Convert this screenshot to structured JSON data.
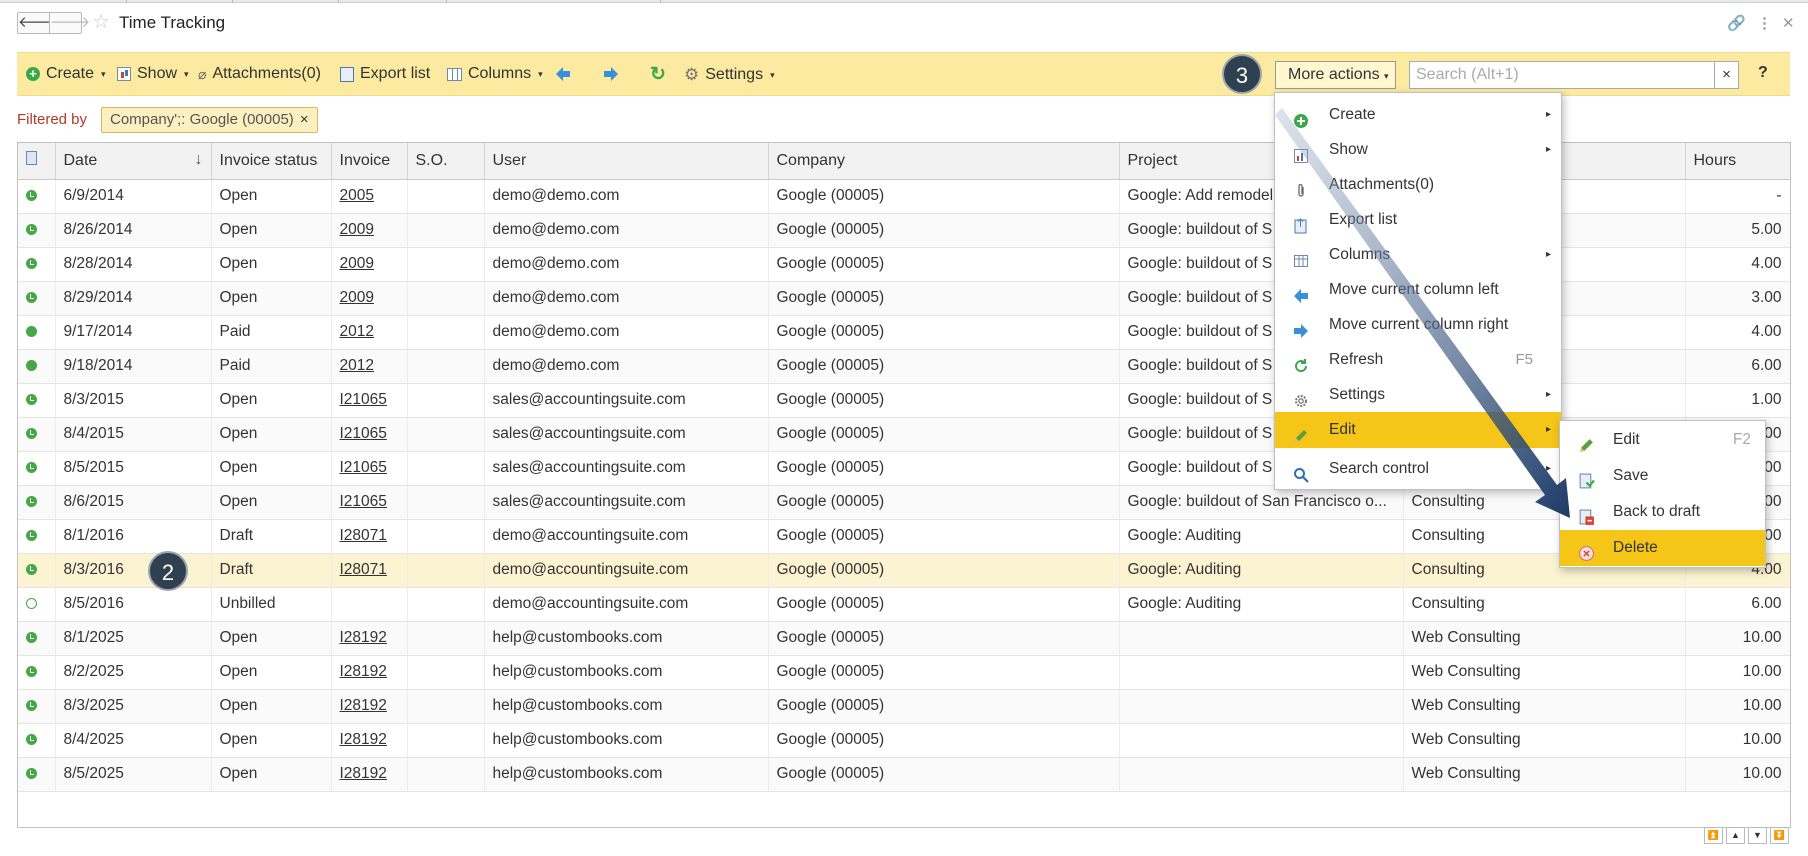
{
  "window": {
    "title": "Time Tracking",
    "nav_back": "🡐",
    "nav_forward": "🡒",
    "star_icon": "☆",
    "link_icon": "🔗",
    "more_icon": "⋮",
    "close_icon": "✕"
  },
  "toolbar": {
    "create": "Create",
    "show": "Show",
    "attachments": "Attachments(0)",
    "export_list": "Export list",
    "columns": "Columns",
    "refresh_icon": "↻",
    "settings": "Settings",
    "more_actions": "More actions",
    "search_placeholder": "Search (Alt+1)",
    "search_clear": "×",
    "help": "?"
  },
  "steps": {
    "two": "2",
    "three": "3"
  },
  "filter": {
    "label": "Filtered by",
    "chip": "Company';: Google (00005)",
    "chip_remove": "×"
  },
  "table": {
    "columns": [
      "Date",
      "Invoice status",
      "Invoice",
      "S.O.",
      "User",
      "Company",
      "Project",
      "",
      "Hours"
    ],
    "sort_indicator": "↓",
    "rows": [
      {
        "status": "open",
        "date": "6/9/2014",
        "inv_status": "Open",
        "invoice": "2005",
        "so": "",
        "user": "demo@demo.com",
        "company": "Google (00005)",
        "project": "Google: Add remodel to",
        "task": "",
        "hours": "-"
      },
      {
        "status": "open",
        "date": "8/26/2014",
        "inv_status": "Open",
        "invoice": "2009",
        "so": "",
        "user": "demo@demo.com",
        "company": "Google (00005)",
        "project": "Google: buildout of S",
        "task": "",
        "hours": "5.00"
      },
      {
        "status": "open",
        "date": "8/28/2014",
        "inv_status": "Open",
        "invoice": "2009",
        "so": "",
        "user": "demo@demo.com",
        "company": "Google (00005)",
        "project": "Google: buildout of S",
        "task": "",
        "hours": "4.00"
      },
      {
        "status": "open",
        "date": "8/29/2014",
        "inv_status": "Open",
        "invoice": "2009",
        "so": "",
        "user": "demo@demo.com",
        "company": "Google (00005)",
        "project": "Google: buildout of S",
        "task": "",
        "hours": "3.00"
      },
      {
        "status": "paid",
        "date": "9/17/2014",
        "inv_status": "Paid",
        "invoice": "2012",
        "so": "",
        "user": "demo@demo.com",
        "company": "Google (00005)",
        "project": "Google: buildout of S",
        "task": "",
        "hours": "4.00"
      },
      {
        "status": "paid",
        "date": "9/18/2014",
        "inv_status": "Paid",
        "invoice": "2012",
        "so": "",
        "user": "demo@demo.com",
        "company": "Google (00005)",
        "project": "Google: buildout of S",
        "task": "",
        "hours": "6.00"
      },
      {
        "status": "open",
        "date": "8/3/2015",
        "inv_status": "Open",
        "invoice": "I21065",
        "so": "",
        "user": "sales@accountingsuite.com",
        "company": "Google (00005)",
        "project": "Google: buildout of S",
        "task": "",
        "hours": "1.00"
      },
      {
        "status": "open",
        "date": "8/4/2015",
        "inv_status": "Open",
        "invoice": "I21065",
        "so": "",
        "user": "sales@accountingsuite.com",
        "company": "Google (00005)",
        "project": "Google: buildout of S",
        "task": "",
        "hours": "1.00"
      },
      {
        "status": "open",
        "date": "8/5/2015",
        "inv_status": "Open",
        "invoice": "I21065",
        "so": "",
        "user": "sales@accountingsuite.com",
        "company": "Google (00005)",
        "project": "Google: buildout of S",
        "task": "",
        "hours": "1.00"
      },
      {
        "status": "open",
        "date": "8/6/2015",
        "inv_status": "Open",
        "invoice": "I21065",
        "so": "",
        "user": "sales@accountingsuite.com",
        "company": "Google (00005)",
        "project": "Google: buildout of San Francisco o...",
        "task": "Consulting",
        "hours": "1.00"
      },
      {
        "status": "open",
        "date": "8/1/2016",
        "inv_status": "Draft",
        "invoice": "I28071",
        "so": "",
        "user": "demo@accountingsuite.com",
        "company": "Google (00005)",
        "project": "Google: Auditing",
        "task": "Consulting",
        "hours": "1.00"
      },
      {
        "status": "open",
        "date": "8/3/2016",
        "inv_status": "Draft",
        "invoice": "I28071",
        "so": "",
        "user": "demo@accountingsuite.com",
        "company": "Google (00005)",
        "project": "Google: Auditing",
        "task": "Consulting",
        "hours": "4.00"
      },
      {
        "status": "empty",
        "date": "8/5/2016",
        "inv_status": "Unbilled",
        "invoice": "",
        "so": "",
        "user": "demo@accountingsuite.com",
        "company": "Google (00005)",
        "project": "Google: Auditing",
        "task": "Consulting",
        "hours": "6.00"
      },
      {
        "status": "open",
        "date": "8/1/2025",
        "inv_status": "Open",
        "invoice": "I28192",
        "so": "",
        "user": "help@custombooks.com",
        "company": "Google (00005)",
        "project": "",
        "task": "Web Consulting",
        "hours": "10.00"
      },
      {
        "status": "open",
        "date": "8/2/2025",
        "inv_status": "Open",
        "invoice": "I28192",
        "so": "",
        "user": "help@custombooks.com",
        "company": "Google (00005)",
        "project": "",
        "task": "Web Consulting",
        "hours": "10.00"
      },
      {
        "status": "open",
        "date": "8/3/2025",
        "inv_status": "Open",
        "invoice": "I28192",
        "so": "",
        "user": "help@custombooks.com",
        "company": "Google (00005)",
        "project": "",
        "task": "Web Consulting",
        "hours": "10.00"
      },
      {
        "status": "open",
        "date": "8/4/2025",
        "inv_status": "Open",
        "invoice": "I28192",
        "so": "",
        "user": "help@custombooks.com",
        "company": "Google (00005)",
        "project": "",
        "task": "Web Consulting",
        "hours": "10.00"
      },
      {
        "status": "open",
        "date": "8/5/2025",
        "inv_status": "Open",
        "invoice": "I28192",
        "so": "",
        "user": "help@custombooks.com",
        "company": "Google (00005)",
        "project": "",
        "task": "Web Consulting",
        "hours": "10.00"
      }
    ]
  },
  "menu": {
    "items": [
      {
        "label": "Create",
        "icon": "create-icon",
        "has_sub": true,
        "key": ""
      },
      {
        "label": "Show",
        "icon": "show-icon",
        "has_sub": true,
        "key": ""
      },
      {
        "label": "Attachments(0)",
        "icon": "paperclip-icon",
        "has_sub": false,
        "key": ""
      },
      {
        "label": "Export list",
        "icon": "export-icon",
        "has_sub": false,
        "key": ""
      },
      {
        "label": "Columns",
        "icon": "columns-icon",
        "has_sub": true,
        "key": ""
      },
      {
        "label": "Move current column left",
        "icon": "arrow-left-icon",
        "has_sub": false,
        "key": ""
      },
      {
        "label": "Move current column right",
        "icon": "arrow-right-icon",
        "has_sub": false,
        "key": ""
      },
      {
        "label": "Refresh",
        "icon": "refresh-icon",
        "has_sub": false,
        "key": "F5"
      },
      {
        "label": "Settings",
        "icon": "gear-icon",
        "has_sub": true,
        "key": ""
      },
      {
        "label": "Edit",
        "icon": "pencil-icon",
        "has_sub": true,
        "key": ""
      },
      {
        "label": "Search control",
        "icon": "search-icon",
        "has_sub": true,
        "key": ""
      }
    ],
    "submenu_arrow": "▸"
  },
  "submenu": {
    "items": [
      {
        "label": "Edit",
        "icon": "pencil-icon",
        "key": "F2"
      },
      {
        "label": "Save",
        "icon": "save-icon",
        "key": ""
      },
      {
        "label": "Back to draft",
        "icon": "back-to-draft-icon",
        "key": ""
      },
      {
        "label": "Delete",
        "icon": "delete-icon",
        "key": ""
      }
    ]
  },
  "pager": {
    "first": "⏫",
    "up": "▲",
    "down": "▼",
    "last": "⏬"
  },
  "colors": {
    "toolbar_bg": "#fbeaa0",
    "highlight": "#f5c518",
    "status_green": "#45a845",
    "filter_red": "#b23a2a"
  }
}
